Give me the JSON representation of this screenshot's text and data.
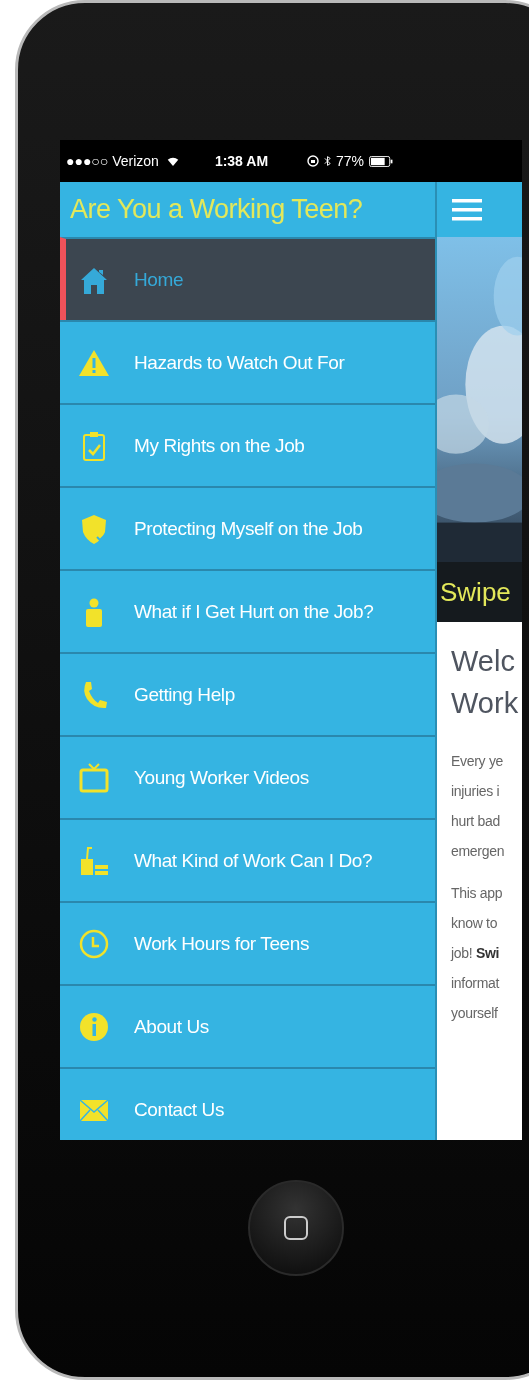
{
  "status_bar": {
    "carrier": "●●●○○ Verizon",
    "time": "1:38 AM",
    "battery": "77%"
  },
  "drawer": {
    "title": "Are You a Working Teen?",
    "items": [
      {
        "label": "Home",
        "selected": true
      },
      {
        "label": "Hazards to Watch Out For",
        "selected": false
      },
      {
        "label": "My Rights on the Job",
        "selected": false
      },
      {
        "label": "Protecting Myself on the Job",
        "selected": false
      },
      {
        "label": "What if I Get Hurt on the Job?",
        "selected": false
      },
      {
        "label": "Getting Help",
        "selected": false
      },
      {
        "label": "Young Worker Videos",
        "selected": false
      },
      {
        "label": "What Kind of Work Can I Do?",
        "selected": false
      },
      {
        "label": "Work Hours for Teens",
        "selected": false
      },
      {
        "label": "About Us",
        "selected": false
      },
      {
        "label": "Contact Us",
        "selected": false
      }
    ]
  },
  "content": {
    "banner": "Swipe",
    "heading_lines": [
      "Welc",
      "Work"
    ],
    "paragraphs": [
      [
        "Every ye",
        "injuries i",
        "hurt bad",
        "emergen"
      ],
      [
        "This app",
        "know to",
        "job! **Swi**",
        "informat",
        "yourself"
      ]
    ]
  }
}
